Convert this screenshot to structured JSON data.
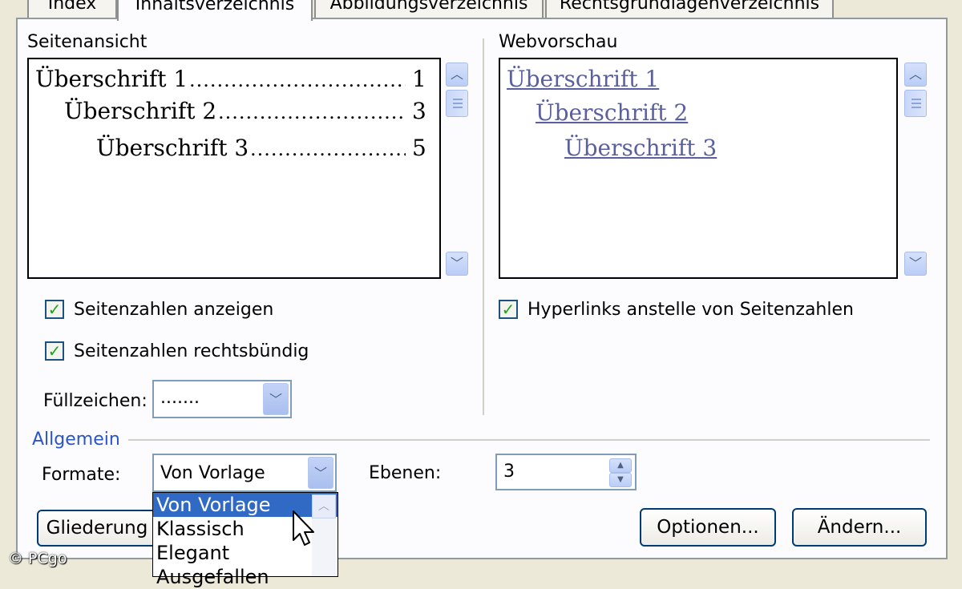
{
  "tabs": [
    "Index",
    "Inhaltsverzeichnis",
    "Abbildungsverzeichnis",
    "Rechtsgrundlagenverzeichnis"
  ],
  "print_preview": {
    "title": "Seitenansicht",
    "entries": [
      {
        "text": "Überschrift 1",
        "page": "1"
      },
      {
        "text": "Überschrift 2",
        "page": "3"
      },
      {
        "text": "Überschrift 3",
        "page": "5"
      }
    ]
  },
  "web_preview": {
    "title": "Webvorschau",
    "entries": [
      "Überschrift 1",
      "Überschrift 2",
      "Überschrift 3"
    ]
  },
  "options": {
    "show_page_numbers": "Seitenzahlen anzeigen",
    "right_align_page_numbers": "Seitenzahlen rechtsbündig",
    "hyperlinks": "Hyperlinks anstelle von Seitenzahlen",
    "show_page_numbers_checked": true,
    "right_align_checked": true,
    "hyperlinks_checked": true
  },
  "leader": {
    "label": "Füllzeichen:",
    "value": "......."
  },
  "general": {
    "title": "Allgemein",
    "formats_label": "Formate:",
    "formats_value": "Von Vorlage",
    "formats_options": [
      "Von Vorlage",
      "Klassisch",
      "Elegant",
      "Ausgefallen"
    ],
    "levels_label": "Ebenen:",
    "levels_value": "3"
  },
  "buttons": {
    "outline": "Gliederung",
    "options": "Optionen...",
    "modify": "Ändern..."
  },
  "watermark": "© PCgo",
  "colors": {
    "selection": "#316AC5",
    "link": "#5A5FA0",
    "section_title": "#2A55C8"
  }
}
